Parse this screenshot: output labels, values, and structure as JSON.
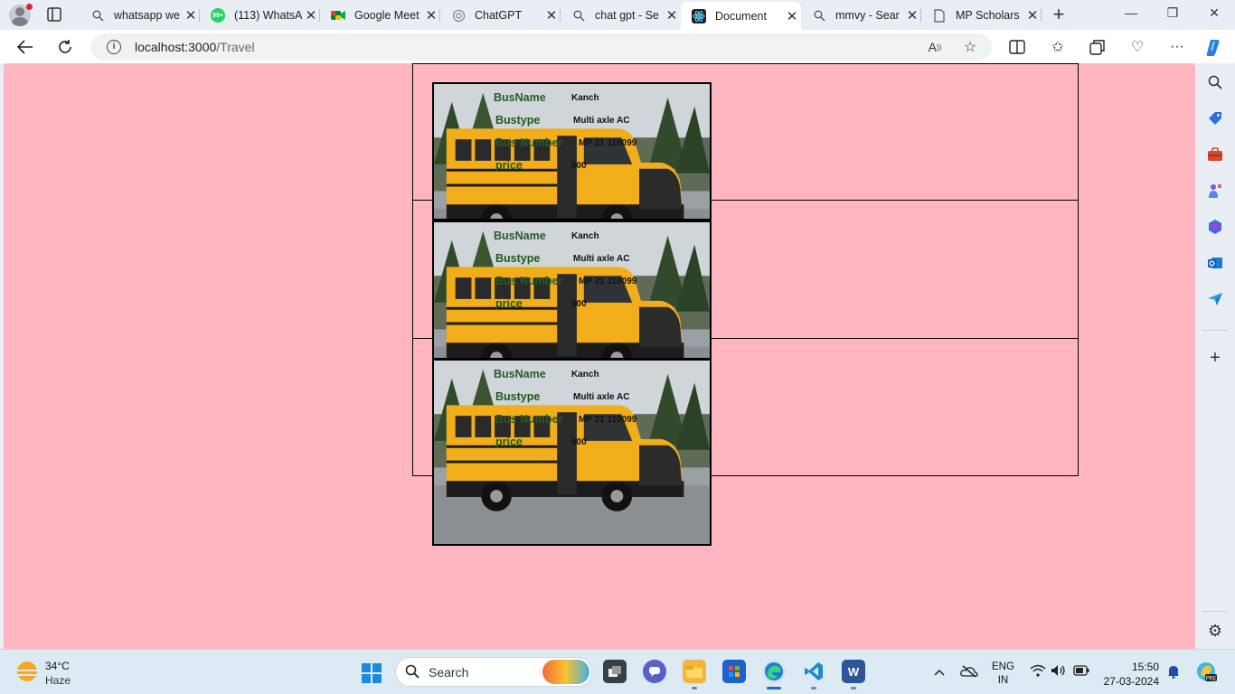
{
  "browser": {
    "tabs": [
      {
        "title": "whatsapp we",
        "icon": "search-icon"
      },
      {
        "title": "(113) WhatsA",
        "icon": "whatsapp-icon",
        "badge": "99+"
      },
      {
        "title": "Google Meet",
        "icon": "google-meet-icon"
      },
      {
        "title": "ChatGPT",
        "icon": "chatgpt-icon"
      },
      {
        "title": "chat gpt - Se",
        "icon": "search-icon"
      },
      {
        "title": "Document",
        "icon": "react-icon",
        "active": true
      },
      {
        "title": "mmvy - Sear",
        "icon": "search-icon"
      },
      {
        "title": "MP Scholars",
        "icon": "document-icon"
      }
    ],
    "url_host": "localhost:3000",
    "url_path": "/Travel"
  },
  "page": {
    "background": "#ffb6c1",
    "cards": [
      {
        "label1": "BusName",
        "value1": "Kanch",
        "label2": "Bustype",
        "value2": "Multi axle AC",
        "label3": "Bus Number",
        "value3": "MP 21 110099",
        "label4": "price",
        "value4": "500"
      },
      {
        "label1": "BusName",
        "value1": "Kanch",
        "label2": "Bustype",
        "value2": "Multi axle AC",
        "label3": "Bus Number",
        "value3": "MP 21 110099",
        "label4": "price",
        "value4": "500"
      },
      {
        "label1": "BusName",
        "value1": "Kanch",
        "label2": "Bustype",
        "value2": "Multi axle AC",
        "label3": "Bus Number",
        "value3": "MP 21 110099",
        "label4": "price",
        "value4": "500"
      }
    ]
  },
  "taskbar": {
    "temperature": "34°C",
    "weather": "Haze",
    "search_label": "Search",
    "language_line1": "ENG",
    "language_line2": "IN",
    "time": "15:50",
    "date": "27-03-2024"
  }
}
